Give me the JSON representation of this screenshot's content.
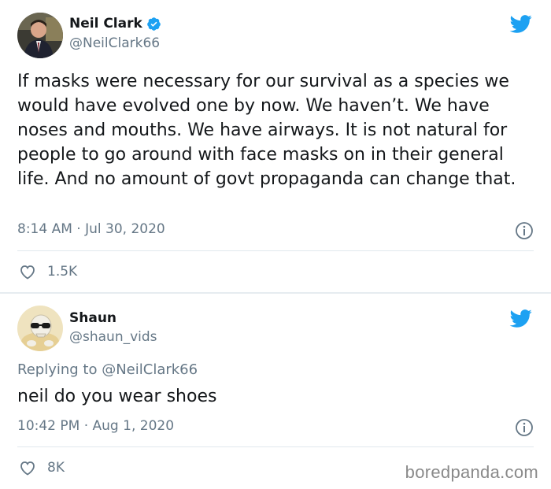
{
  "colors": {
    "twitter_blue": "#1da1f2",
    "secondary_text": "#657786",
    "primary_text": "#14171a",
    "separator": "#e6ecf0"
  },
  "tweets": [
    {
      "author_name": "Neil Clark",
      "verified": true,
      "handle": "@NeilClark66",
      "text": "If masks were necessary for our survival as a species we would have evolved one by now. We haven’t. We have noses and mouths. We have airways. It is not natural for people to go around with face masks on in their general life. And no amount of govt propaganda can change that.",
      "timestamp": "8:14 AM · Jul 30, 2020",
      "likes": "1.5K",
      "icons": {
        "brand": "twitter-bird-icon",
        "info": "info-icon",
        "like": "heart-icon",
        "verified": "verified-badge-icon"
      }
    },
    {
      "author_name": "Shaun",
      "handle": "@shaun_vids",
      "replying_to_label": "Replying to",
      "replying_to_handle": "@NeilClark66",
      "text": "neil do you wear shoes",
      "timestamp": "10:42 PM · Aug 1, 2020",
      "likes": "8K",
      "icons": {
        "brand": "twitter-bird-icon",
        "info": "info-icon",
        "like": "heart-icon"
      }
    }
  ],
  "watermark": "boredpanda.com"
}
